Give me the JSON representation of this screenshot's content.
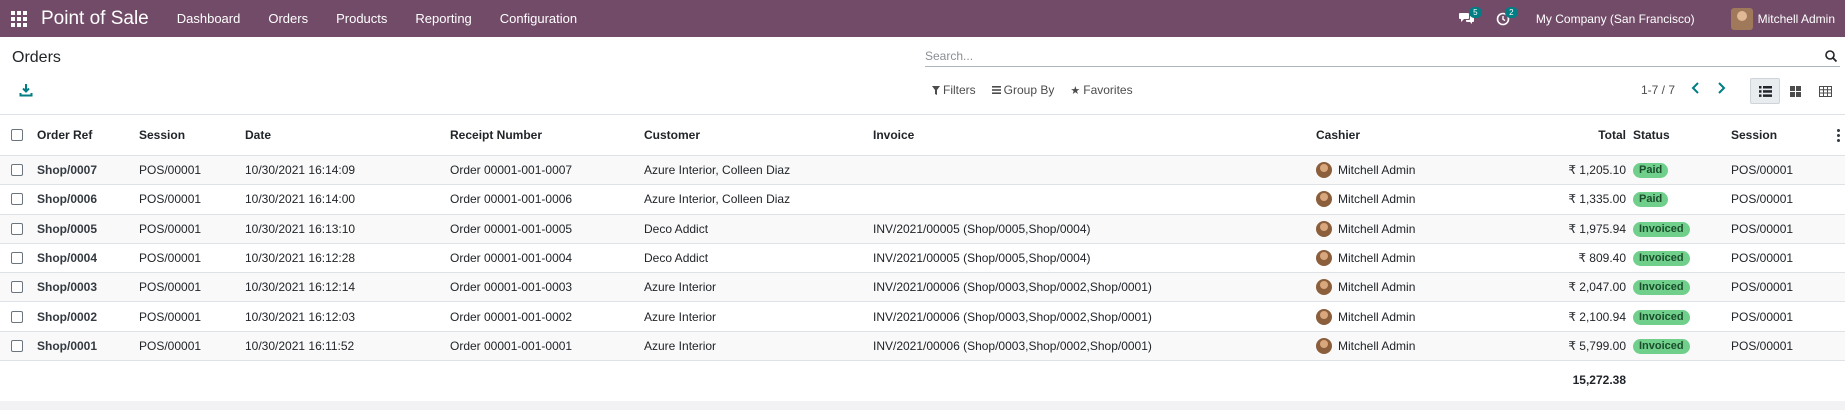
{
  "app": {
    "brand": "Point of Sale",
    "menu": [
      "Dashboard",
      "Orders",
      "Products",
      "Reporting",
      "Configuration"
    ],
    "messages_count": "5",
    "activities_count": "2",
    "company": "My Company (San Francisco)",
    "user": "Mitchell Admin"
  },
  "control": {
    "title": "Orders",
    "search_placeholder": "Search...",
    "filters_label": "Filters",
    "groupby_label": "Group By",
    "favorites_label": "Favorites",
    "pager": "1-7 / 7",
    "active_view": "list"
  },
  "table": {
    "columns": [
      "Order Ref",
      "Session",
      "Date",
      "Receipt Number",
      "Customer",
      "Invoice",
      "Cashier",
      "Total",
      "Status",
      "Session"
    ],
    "rows": [
      {
        "ref": "Shop/0007",
        "session": "POS/00001",
        "date": "10/30/2021 16:14:09",
        "receipt": "Order 00001-001-0007",
        "customer": "Azure Interior, Colleen Diaz",
        "invoice": "",
        "cashier": "Mitchell Admin",
        "total": "₹ 1,205.10",
        "status": "Paid",
        "session2": "POS/00001"
      },
      {
        "ref": "Shop/0006",
        "session": "POS/00001",
        "date": "10/30/2021 16:14:00",
        "receipt": "Order 00001-001-0006",
        "customer": "Azure Interior, Colleen Diaz",
        "invoice": "",
        "cashier": "Mitchell Admin",
        "total": "₹ 1,335.00",
        "status": "Paid",
        "session2": "POS/00001"
      },
      {
        "ref": "Shop/0005",
        "session": "POS/00001",
        "date": "10/30/2021 16:13:10",
        "receipt": "Order 00001-001-0005",
        "customer": "Deco Addict",
        "invoice": "INV/2021/00005 (Shop/0005,Shop/0004)",
        "cashier": "Mitchell Admin",
        "total": "₹ 1,975.94",
        "status": "Invoiced",
        "session2": "POS/00001"
      },
      {
        "ref": "Shop/0004",
        "session": "POS/00001",
        "date": "10/30/2021 16:12:28",
        "receipt": "Order 00001-001-0004",
        "customer": "Deco Addict",
        "invoice": "INV/2021/00005 (Shop/0005,Shop/0004)",
        "cashier": "Mitchell Admin",
        "total": "₹ 809.40",
        "status": "Invoiced",
        "session2": "POS/00001"
      },
      {
        "ref": "Shop/0003",
        "session": "POS/00001",
        "date": "10/30/2021 16:12:14",
        "receipt": "Order 00001-001-0003",
        "customer": "Azure Interior",
        "invoice": "INV/2021/00006 (Shop/0003,Shop/0002,Shop/0001)",
        "cashier": "Mitchell Admin",
        "total": "₹ 2,047.00",
        "status": "Invoiced",
        "session2": "POS/00001"
      },
      {
        "ref": "Shop/0002",
        "session": "POS/00001",
        "date": "10/30/2021 16:12:03",
        "receipt": "Order 00001-001-0002",
        "customer": "Azure Interior",
        "invoice": "INV/2021/00006 (Shop/0003,Shop/0002,Shop/0001)",
        "cashier": "Mitchell Admin",
        "total": "₹ 2,100.94",
        "status": "Invoiced",
        "session2": "POS/00001"
      },
      {
        "ref": "Shop/0001",
        "session": "POS/00001",
        "date": "10/30/2021 16:11:52",
        "receipt": "Order 00001-001-0001",
        "customer": "Azure Interior",
        "invoice": "INV/2021/00006 (Shop/0003,Shop/0002,Shop/0001)",
        "cashier": "Mitchell Admin",
        "total": "₹ 5,799.00",
        "status": "Invoiced",
        "session2": "POS/00001"
      }
    ],
    "grand_total": "15,272.38"
  },
  "colors": {
    "navbar": "#714B67",
    "accent": "#017e84",
    "status_badge": "#6fcf8b"
  }
}
